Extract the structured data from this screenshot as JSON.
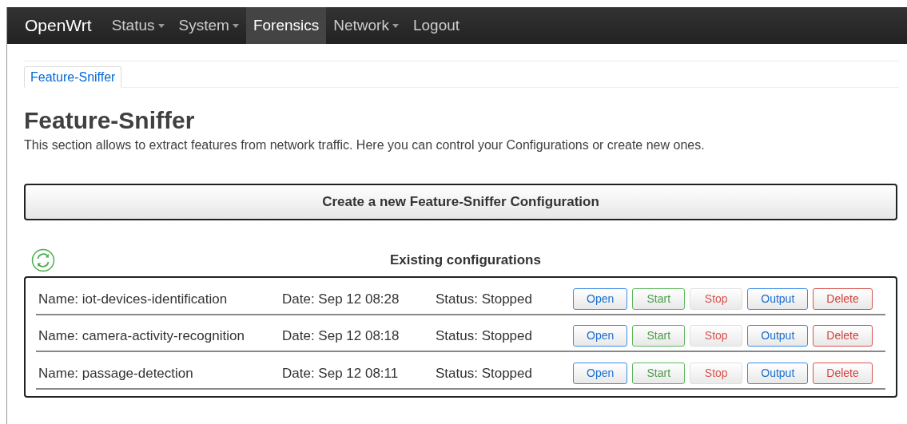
{
  "navbar": {
    "brand": "OpenWrt",
    "items": [
      {
        "label": "Status",
        "dropdown": true,
        "selected": false
      },
      {
        "label": "System",
        "dropdown": true,
        "selected": false
      },
      {
        "label": "Forensics",
        "dropdown": false,
        "selected": true
      },
      {
        "label": "Network",
        "dropdown": true,
        "selected": false
      },
      {
        "label": "Logout",
        "dropdown": false,
        "selected": false
      }
    ]
  },
  "tabs": [
    {
      "label": "Feature-Sniffer",
      "selected": true
    }
  ],
  "heading": "Feature-Sniffer",
  "description": "This section allows to extract features from network traffic. Here you can control your Configurations or create new ones.",
  "create_button": "Create a new Feature-Sniffer Configuration",
  "list_title": "Existing configurations",
  "configurations": [
    {
      "name": "Name: iot-devices-identification",
      "date": "Date: Sep 12 08:28",
      "status": "Status: Stopped",
      "buttons": [
        {
          "label": "Open",
          "kind": "open",
          "disabled": false
        },
        {
          "label": "Start",
          "kind": "start",
          "disabled": false
        },
        {
          "label": "Stop",
          "kind": "stop",
          "disabled": true
        },
        {
          "label": "Output",
          "kind": "open",
          "disabled": false
        },
        {
          "label": "Delete",
          "kind": "stop",
          "disabled": false
        }
      ]
    },
    {
      "name": "Name: camera-activity-recognition",
      "date": "Date: Sep 12 08:18",
      "status": "Status: Stopped",
      "buttons": [
        {
          "label": "Open",
          "kind": "open",
          "disabled": false
        },
        {
          "label": "Start",
          "kind": "start",
          "disabled": false
        },
        {
          "label": "Stop",
          "kind": "stop",
          "disabled": true
        },
        {
          "label": "Output",
          "kind": "open",
          "disabled": false
        },
        {
          "label": "Delete",
          "kind": "stop",
          "disabled": false
        }
      ]
    },
    {
      "name": "Name: passage-detection",
      "date": "Date: Sep 12 08:11",
      "status": "Status: Stopped",
      "buttons": [
        {
          "label": "Open",
          "kind": "open",
          "disabled": false
        },
        {
          "label": "Start",
          "kind": "start",
          "disabled": false
        },
        {
          "label": "Stop",
          "kind": "stop",
          "disabled": true
        },
        {
          "label": "Output",
          "kind": "open",
          "disabled": false
        },
        {
          "label": "Delete",
          "kind": "stop",
          "disabled": false
        }
      ]
    }
  ]
}
